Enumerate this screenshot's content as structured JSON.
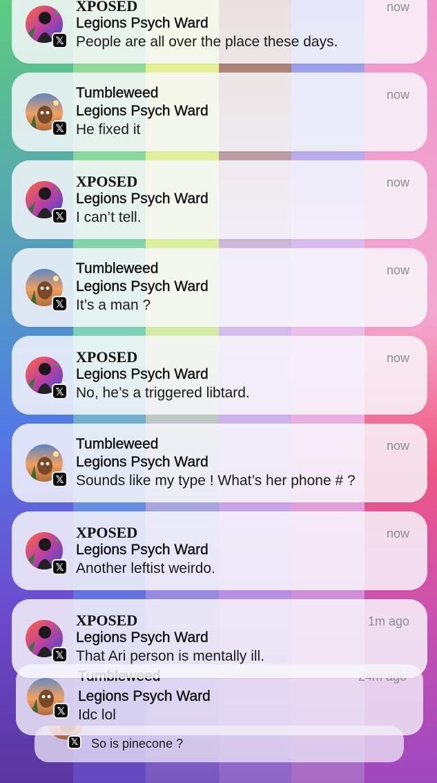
{
  "wallpaper": {
    "stripes": [
      "#6fd07c",
      "#95dca0",
      "#dfe88c",
      "#c9b0e8",
      "#f2b7d8",
      "#f3a3c4",
      "#f0a1b8"
    ]
  },
  "notifications": [
    {
      "sender": "XPOSED",
      "group": "Legions Psych Ward",
      "message": "People are all over the place these days.",
      "time": "now",
      "avatar": "xposed"
    },
    {
      "sender": "Tumbleweed",
      "group": "Legions Psych Ward",
      "message": "He fixed it",
      "time": "now",
      "avatar": "tumbleweed"
    },
    {
      "sender": "XPOSED",
      "group": "Legions Psych Ward",
      "message": "I can’t tell.",
      "time": "now",
      "avatar": "xposed"
    },
    {
      "sender": "Tumbleweed",
      "group": "Legions Psych Ward",
      "message": "It’s a man ?",
      "time": "now",
      "avatar": "tumbleweed"
    },
    {
      "sender": "XPOSED",
      "group": "Legions Psych Ward",
      "message": "No, he’s a triggered libtard.",
      "time": "now",
      "avatar": "xposed"
    },
    {
      "sender": "Tumbleweed",
      "group": "Legions Psych Ward",
      "message": "Sounds like my type ! What’s her phone # ?",
      "time": "now",
      "avatar": "tumbleweed"
    },
    {
      "sender": "XPOSED",
      "group": "Legions Psych Ward",
      "message": "Another leftist weirdo.",
      "time": "now",
      "avatar": "xposed"
    },
    {
      "sender": "XPOSED",
      "group": "Legions Psych Ward",
      "message": "That Ari person is mentally ill.",
      "time": "1m ago",
      "avatar": "xposed"
    }
  ],
  "stacked": [
    {
      "sender": "Tumbleweed",
      "group": "Legions Psych Ward",
      "message": "Idc lol",
      "time": "24m ago"
    },
    {
      "message": "So is pinecone ?"
    }
  ],
  "app_badge_icon": "x-logo-icon",
  "badge_glyph": "𝕏"
}
